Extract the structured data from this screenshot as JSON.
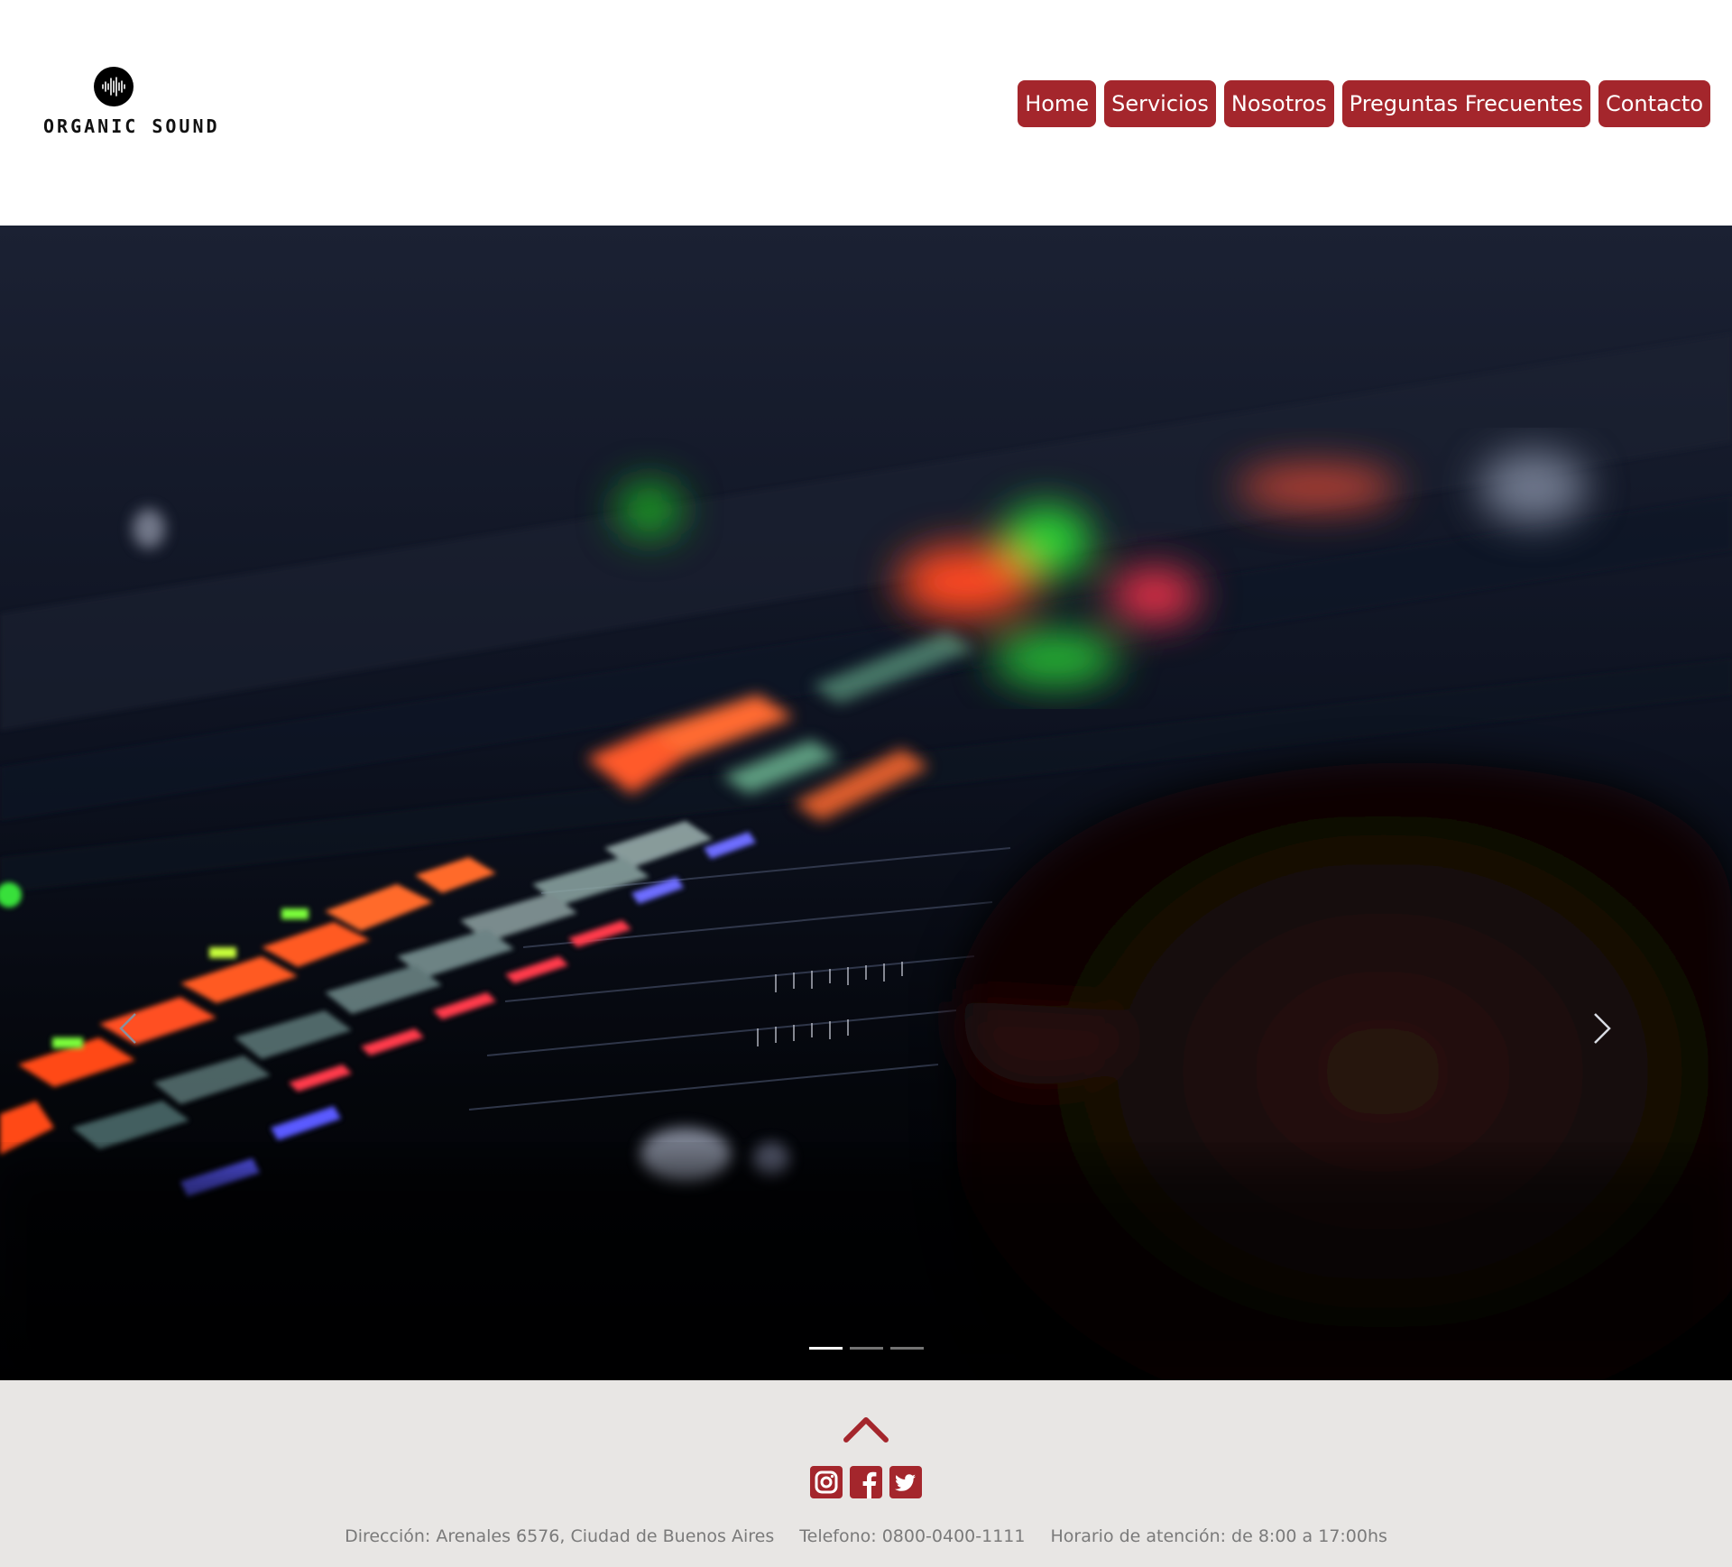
{
  "brand": {
    "logo_text": "ORGANIC SOUND"
  },
  "nav": {
    "items": [
      {
        "label": "Home"
      },
      {
        "label": "Servicios"
      },
      {
        "label": "Nosotros"
      },
      {
        "label": "Preguntas Frecuentes"
      },
      {
        "label": "Contacto"
      }
    ]
  },
  "carousel": {
    "slide_count": 3,
    "active_slide": 1
  },
  "footer": {
    "address": "Dirección: Arenales 6576, Ciudad de Buenos Aires",
    "phone": "Telefono: 0800-0400-1111",
    "hours": "Horario de atención: de 8:00 a 17:00hs",
    "social": [
      "instagram-icon",
      "facebook-icon",
      "twitter-icon"
    ]
  },
  "colors": {
    "accent": "#a4262c",
    "footer_bg": "#e8e6e4",
    "text_muted": "#7a7a7a"
  }
}
